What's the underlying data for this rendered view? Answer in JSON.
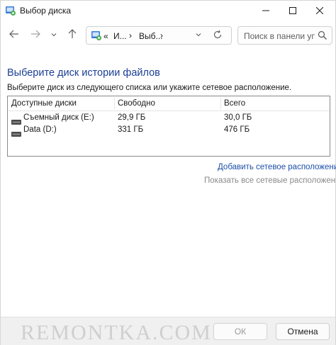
{
  "window": {
    "title": "Выбор диска",
    "icon": "control-panel-icon"
  },
  "titlebar": {
    "minimize_icon": "minimize-icon",
    "maximize_icon": "maximize-icon",
    "close_icon": "close-icon"
  },
  "nav": {
    "back_icon": "arrow-left-icon",
    "forward_icon": "arrow-right-icon",
    "history_icon": "chevron-down-icon",
    "up_icon": "arrow-up-icon"
  },
  "address": {
    "more": "«",
    "segments": [
      "И...",
      "Выб..."
    ],
    "separator": "›"
  },
  "search": {
    "placeholder": "Поиск в панели уп..."
  },
  "content": {
    "heading": "Выберите диск истории файлов",
    "instruction": "Выберите диск из следующего списка или укажите сетевое расположение."
  },
  "drives": {
    "columns": [
      "Доступные диски",
      "Свободно",
      "Всего"
    ],
    "rows": [
      {
        "name": "Съемный диск (E:)",
        "free": "29,9 ГБ",
        "total": "30,0 ГБ",
        "icon": "removable-drive-icon"
      },
      {
        "name": "Data (D:)",
        "free": "331 ГБ",
        "total": "476 ГБ",
        "icon": "hard-drive-icon"
      }
    ]
  },
  "links": {
    "add_network": "Добавить сетевое расположение",
    "show_network": "Показать все сетевые расположения"
  },
  "footer": {
    "watermark": "REMONTKA.COM",
    "ok_label": "ОК",
    "cancel_label": "Отмена"
  },
  "colors": {
    "heading": "#1c3f94",
    "link": "#1c4fa8",
    "disabled_text": "#8a8a8a",
    "footer_bg": "#f0f0f0"
  }
}
